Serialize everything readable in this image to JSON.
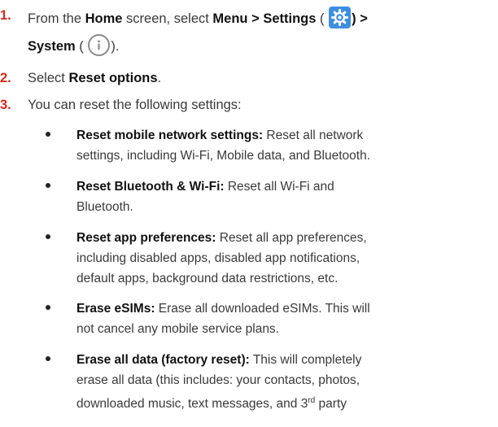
{
  "steps": [
    {
      "num": "1.",
      "part_from": "From the ",
      "home": "Home",
      "part_screen": " screen, select ",
      "menu": "Menu",
      "gt1": " > ",
      "settings": "Settings",
      "paren_open1": " (",
      "paren_close1": ") >",
      "system": "System",
      "paren_open2": " (",
      "paren_close2": ")."
    },
    {
      "num": "2.",
      "pre": "Select ",
      "bold": "Reset options",
      "post": "."
    },
    {
      "num": "3.",
      "text": "You can reset the following settings:"
    }
  ],
  "icons": {
    "settings": "gear-icon",
    "system": "info-icon",
    "settings_color": "#3f8fe0",
    "number_color": "#d52a1e"
  },
  "bullets": [
    {
      "title": "Reset mobile network settings:",
      "line1": " Reset all network",
      "line2": "settings, including Wi-Fi, Mobile data, and Bluetooth."
    },
    {
      "title": "Reset Bluetooth & Wi-Fi:",
      "line1": " Reset all Wi-Fi and",
      "line2": "Bluetooth."
    },
    {
      "title": "Reset app preferences:",
      "line1": " Reset all app preferences,",
      "line2": "including disabled apps, disabled app notifications,",
      "line3": "default apps, background data restrictions, etc."
    },
    {
      "title": "Erase eSIMs:",
      "line1": " Erase all downloaded eSIMs. This will",
      "line2": "not cancel any mobile service plans."
    },
    {
      "title": "Erase all data (factory reset):",
      "line1": " This will completely",
      "line2": "erase all data (this includes: your contacts, photos,",
      "line3a": "downloaded music, text messages, and 3",
      "sup": "rd",
      "line3b": " party"
    }
  ]
}
